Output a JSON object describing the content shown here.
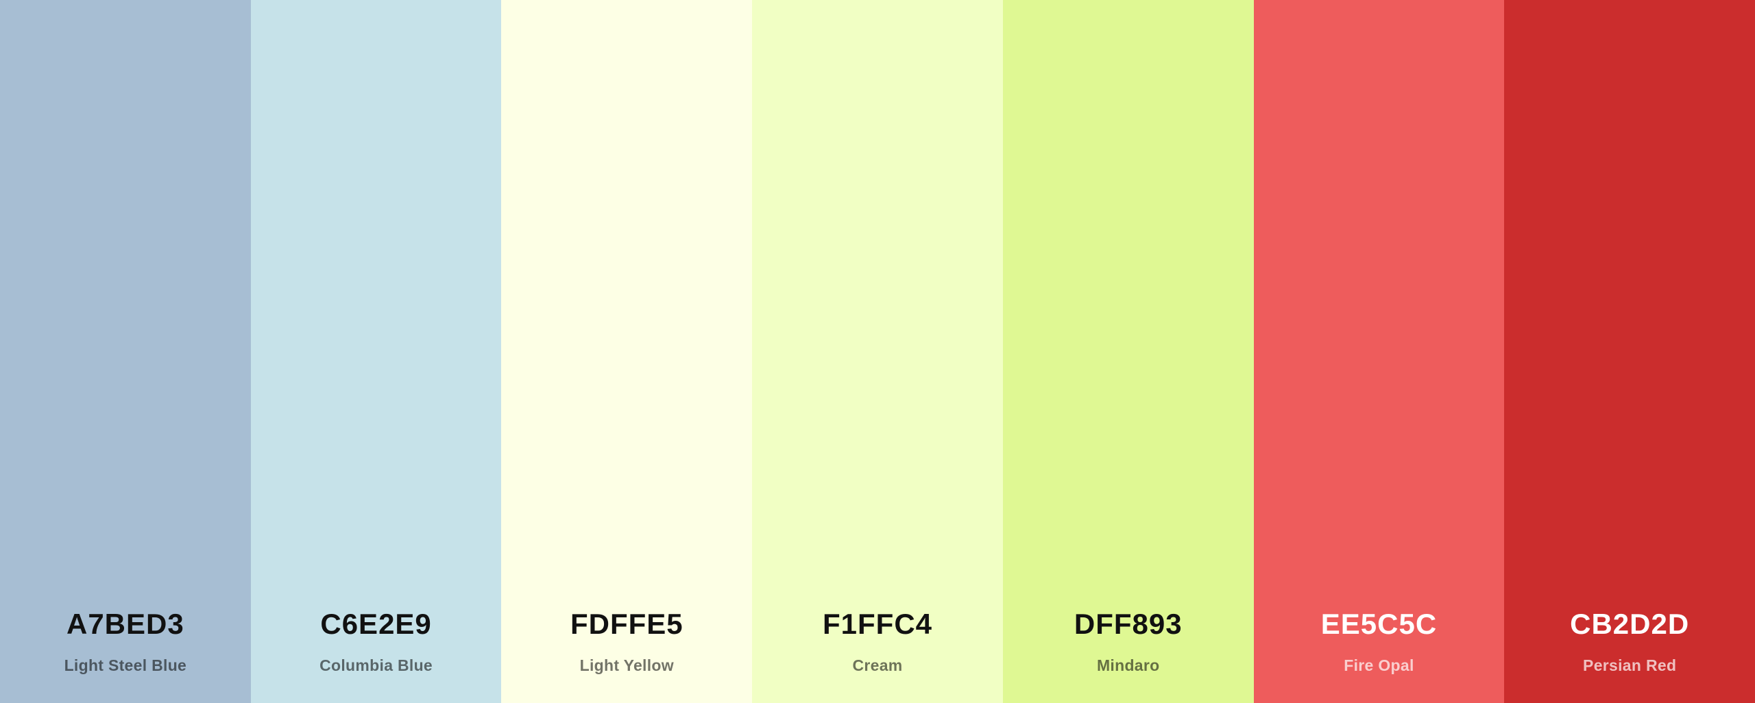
{
  "palette": {
    "swatches": [
      {
        "hex": "A7BED3",
        "name": "Light Steel Blue",
        "color": "#A7BED3",
        "text_tone": "dark"
      },
      {
        "hex": "C6E2E9",
        "name": "Columbia Blue",
        "color": "#C6E2E9",
        "text_tone": "dark"
      },
      {
        "hex": "FDFFE5",
        "name": "Light Yellow",
        "color": "#FDFFE5",
        "text_tone": "dark"
      },
      {
        "hex": "F1FFC4",
        "name": "Cream",
        "color": "#F1FFC4",
        "text_tone": "dark"
      },
      {
        "hex": "DFF893",
        "name": "Mindaro",
        "color": "#DFF893",
        "text_tone": "dark"
      },
      {
        "hex": "EE5C5C",
        "name": "Fire Opal",
        "color": "#EE5C5C",
        "text_tone": "light"
      },
      {
        "hex": "CB2D2D",
        "name": "Persian Red",
        "color": "#CB2D2D",
        "text_tone": "light"
      }
    ]
  }
}
